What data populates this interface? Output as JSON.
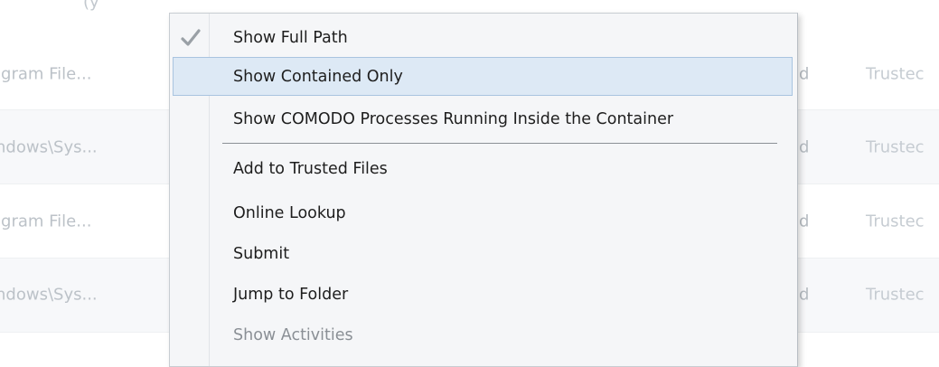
{
  "background_list": {
    "top_fragment": "(y",
    "rows": [
      {
        "path": "ogram File...",
        "rating": "d",
        "status": "Trustec"
      },
      {
        "path": "indows\\Sys...",
        "rating": "d",
        "status": "Trustec"
      },
      {
        "path": "ogram File...",
        "rating": "d",
        "status": "Trustec"
      },
      {
        "path": "indows\\Sys...",
        "rating": "d",
        "status": "Trustec"
      }
    ]
  },
  "context_menu": {
    "items": [
      {
        "label": "Show Full Path",
        "checked": true,
        "state": "normal"
      },
      {
        "label": "Show Contained Only",
        "checked": false,
        "state": "highlighted"
      },
      {
        "label": "Show COMODO Processes Running Inside the Container",
        "checked": false,
        "state": "normal"
      },
      {
        "label": "Add to Trusted Files",
        "checked": false,
        "state": "normal"
      },
      {
        "label": "Online Lookup",
        "checked": false,
        "state": "normal"
      },
      {
        "label": "Submit",
        "checked": false,
        "state": "normal"
      },
      {
        "label": "Jump to Folder",
        "checked": false,
        "state": "normal"
      },
      {
        "label": "Show Activities",
        "checked": false,
        "state": "disabled"
      }
    ],
    "icons": {
      "check": "check-icon"
    },
    "colors": {
      "highlight": "#dde9f5",
      "highlight_border": "#a9c4e0",
      "disabled_text": "#8a8f95"
    }
  }
}
